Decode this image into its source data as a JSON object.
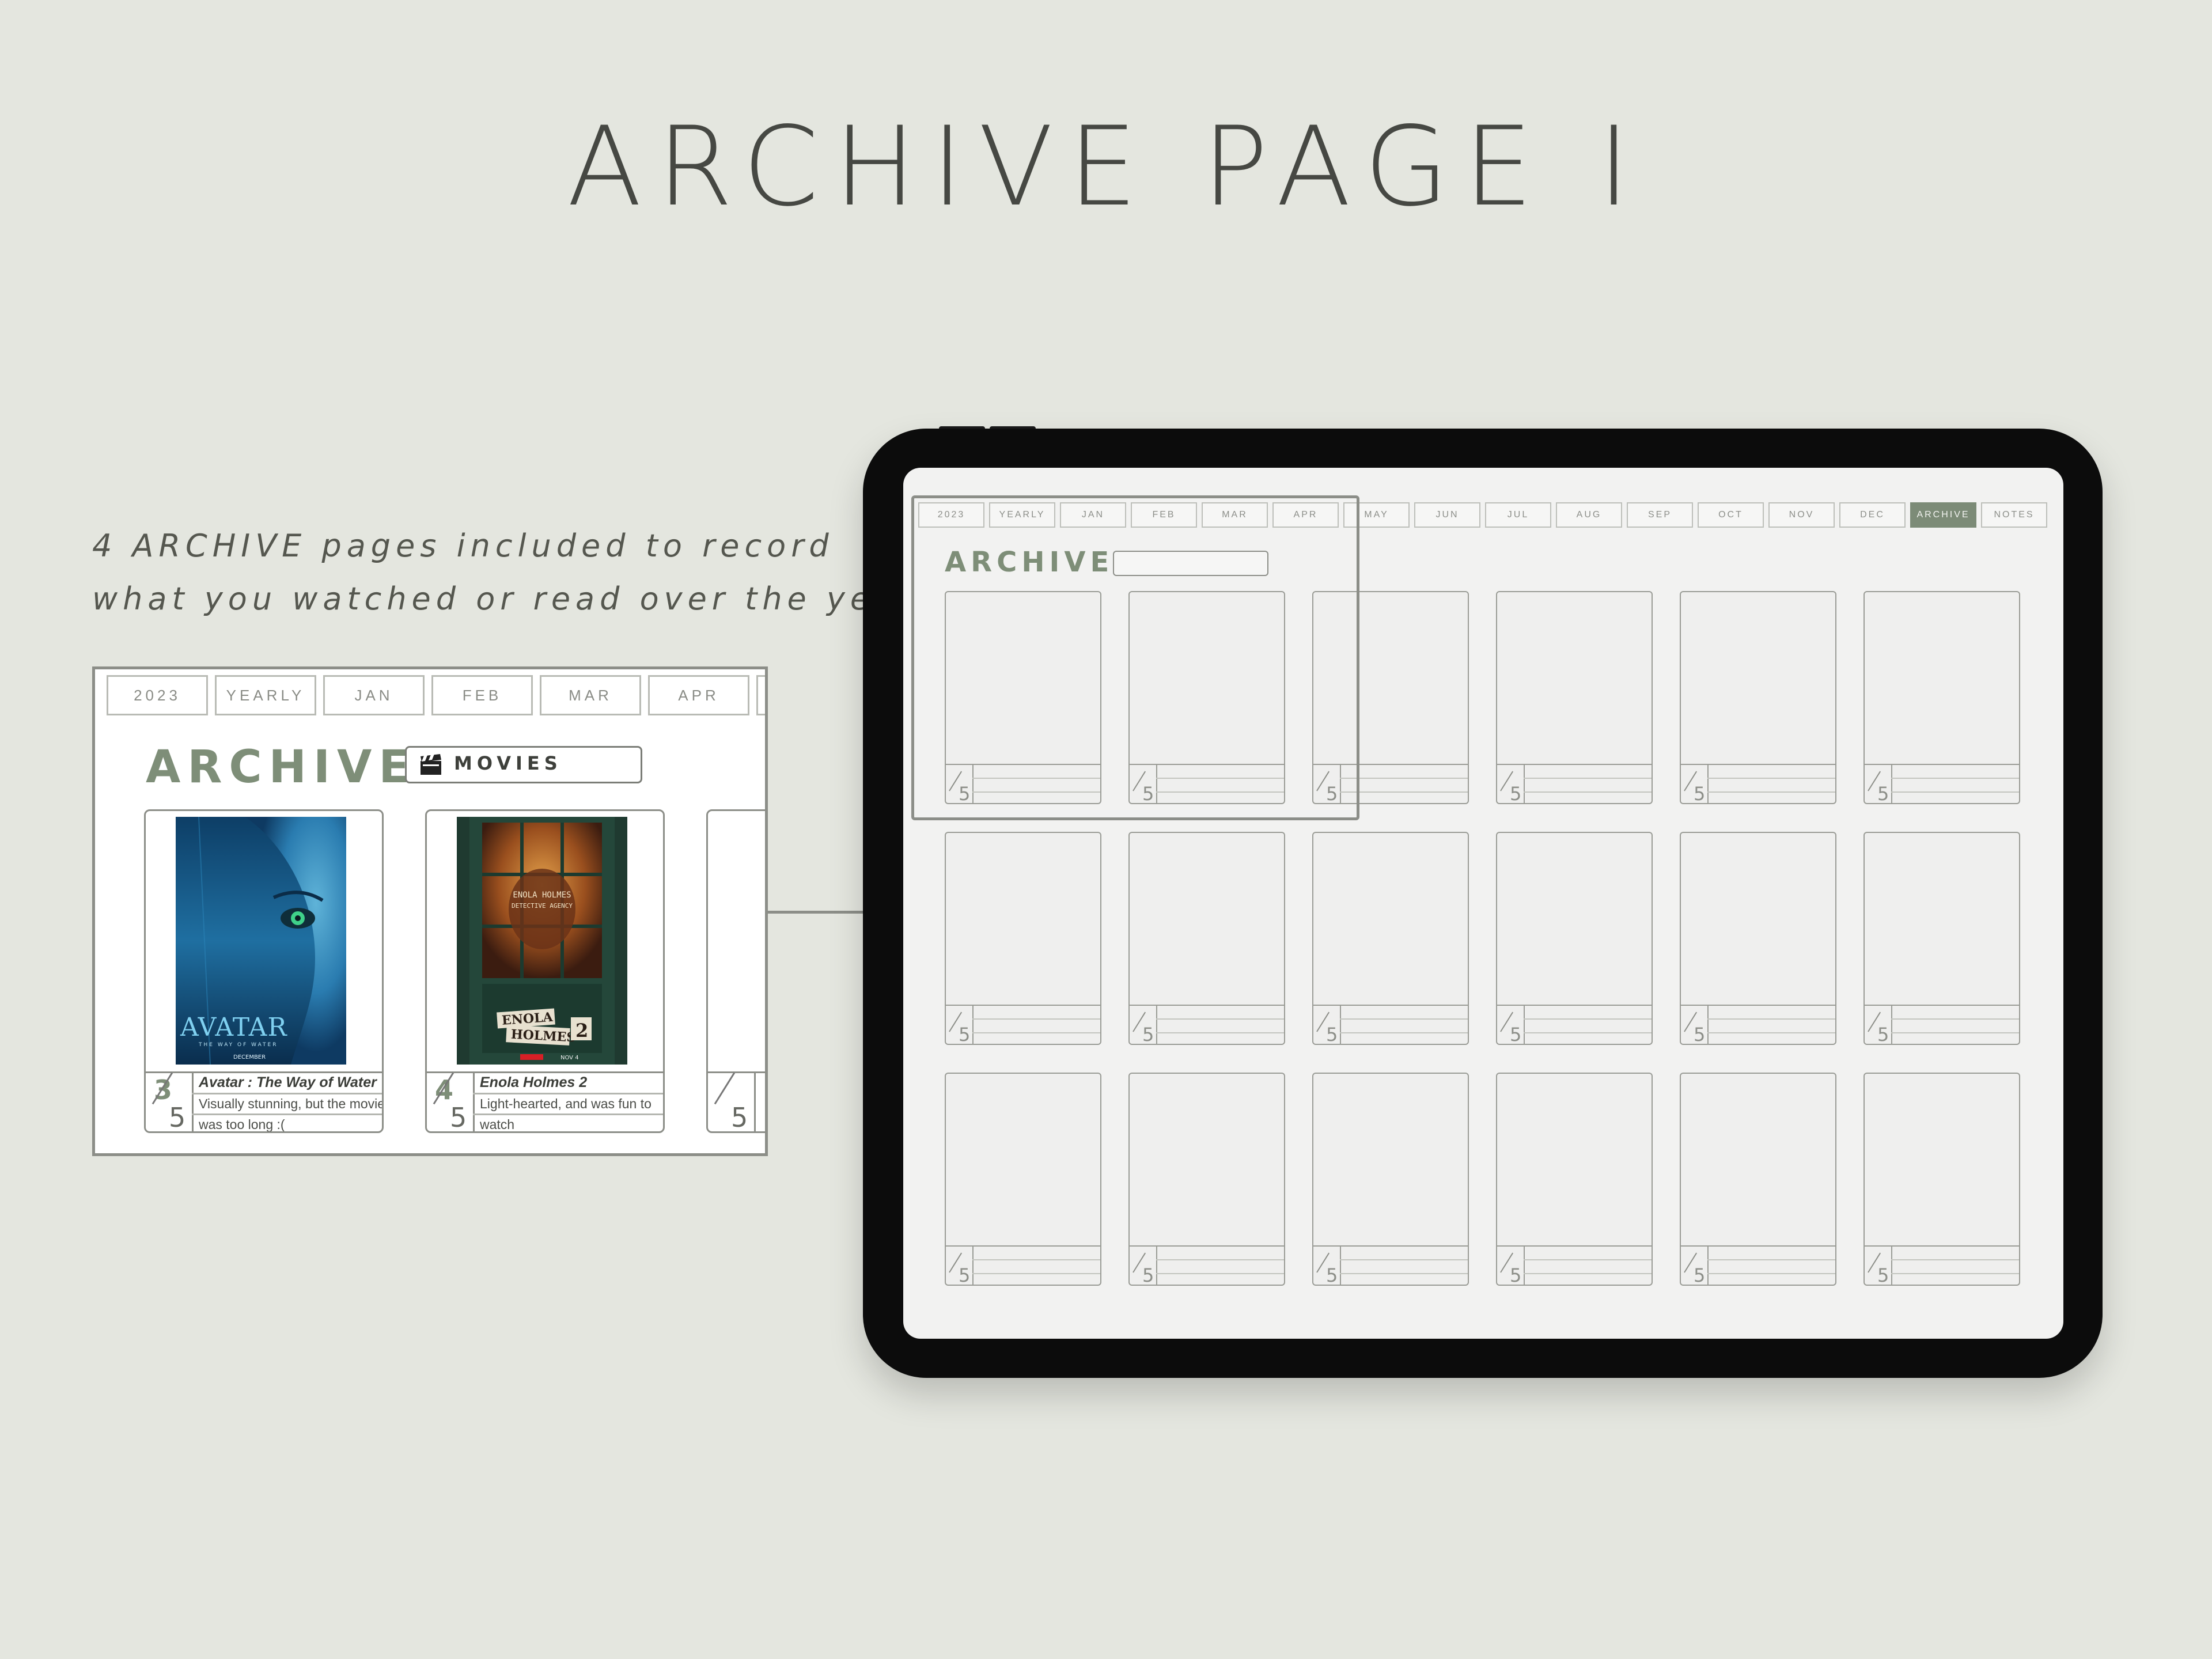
{
  "title": "ARCHIVE PAGE I",
  "caption": {
    "line1": "4 ARCHIVE pages included to record",
    "line2": "what you watched or read over the year!"
  },
  "zoom": {
    "tabs": [
      "2023",
      "YEARLY",
      "JAN",
      "FEB",
      "MAR",
      "APR"
    ],
    "heading": "ARCHIVE",
    "category_icon": "clapperboard-icon",
    "category_label": "MOVIES",
    "cards": [
      {
        "title": "Avatar : The Way of Water",
        "rating": "3",
        "rating_max": "5",
        "note_line1": "Visually stunning, but the movie",
        "note_line2": "was too long :(",
        "poster_title": "AVATAR",
        "poster_subtitle": "THE WAY OF WATER",
        "poster_date": "DECEMBER"
      },
      {
        "title": "Enola Holmes 2",
        "rating": "4",
        "rating_max": "5",
        "note_line1": "Light-hearted, and was fun to",
        "note_line2": "watch",
        "poster_sign1": "ENOLA HOLMES",
        "poster_sign2": "DETECTIVE AGENCY",
        "poster_title1": "ENOLA",
        "poster_title2": "HOLMES",
        "poster_num": "2",
        "poster_date": "NOV 4"
      },
      {
        "rating_max": "5"
      }
    ]
  },
  "tablet": {
    "tabs": [
      "2023",
      "YEARLY",
      "JAN",
      "FEB",
      "MAR",
      "APR",
      "MAY",
      "JUN",
      "JUL",
      "AUG",
      "SEP",
      "OCT",
      "NOV",
      "DEC",
      "ARCHIVE",
      "NOTES"
    ],
    "active_tab": "ARCHIVE",
    "heading": "ARCHIVE",
    "card_rating_max": "5"
  },
  "colors": {
    "background": "#e4e6df",
    "accent_green": "#7c8b77",
    "text_dark": "#464843"
  }
}
